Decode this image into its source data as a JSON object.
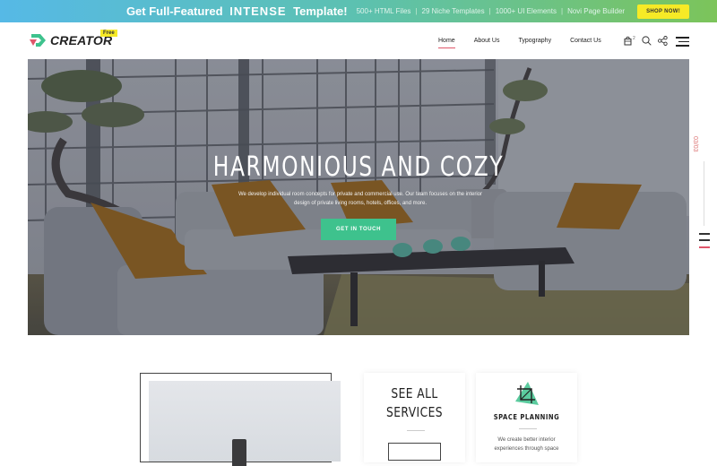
{
  "promo": {
    "headline_pre": "Get Full-Featured",
    "headline_brand": "INTENSE",
    "headline_post": "Template!",
    "features": [
      "500+ HTML Files",
      "29 Niche Templates",
      "1000+ UI Elements",
      "Novi Page Builder"
    ],
    "shop_label": "SHOP NOW!"
  },
  "header": {
    "logo_text": "CREATOR",
    "logo_badge": "Free",
    "nav": [
      {
        "label": "Home",
        "active": true
      },
      {
        "label": "About Us",
        "active": false
      },
      {
        "label": "Typography",
        "active": false
      },
      {
        "label": "Contact Us",
        "active": false
      }
    ],
    "cart_count": "2",
    "icons": [
      "cart-icon",
      "search-icon",
      "share-icon",
      "menu-icon"
    ]
  },
  "hero": {
    "title": "HARMONIOUS AND COZY",
    "description": "We develop individual room concepts for private and commercial use. Our team focuses on the interior design of private living rooms, hotels, offices, and more.",
    "cta_label": "GET IN TOUCH",
    "accent_color": "#3ec28d"
  },
  "slider": {
    "counter": "03/03"
  },
  "services": {
    "see_all_title_line1": "SEE ALL",
    "see_all_title_line2": "SERVICES",
    "card_title": "SPACE PLANNING",
    "card_desc": "We create better interior experiences through space"
  },
  "colors": {
    "promo_button": "#f6ea26",
    "nav_active_underline": "#e0566a",
    "cta": "#3ec28d"
  }
}
